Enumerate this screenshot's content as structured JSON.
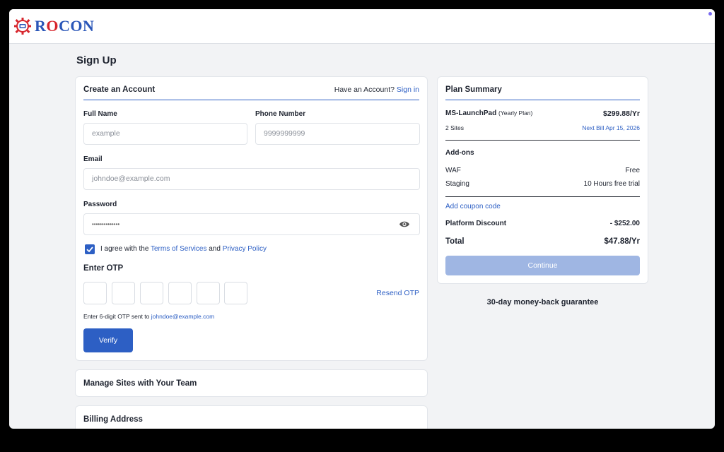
{
  "brand": {
    "name_part1": "R",
    "name_o": "O",
    "name_part2": "C",
    "name_o2": "O",
    "name_part3": "N",
    "color": "#2a56b8",
    "accent": "#d7262d"
  },
  "page": {
    "title": "Sign Up"
  },
  "account": {
    "title": "Create an Account",
    "have_account": "Have an Account?",
    "sign_in": "Sign in",
    "full_name_label": "Full Name",
    "full_name_placeholder": "example",
    "phone_label": "Phone Number",
    "phone_placeholder": "9999999999",
    "email_label": "Email",
    "email_placeholder": "johndoe@example.com",
    "password_label": "Password",
    "password_value": "••••••••••••••",
    "agree_prefix": "I agree with the",
    "terms": "Terms of Services",
    "agree_and": "and",
    "privacy": "Privacy Policy",
    "terms_checked": true,
    "otp_title": "Enter OTP",
    "resend": "Resend OTP",
    "otp_hint_prefix": "Enter 6-digit OTP sent to",
    "otp_hint_email": "johndoe@example.com",
    "verify": "Verify"
  },
  "team": {
    "title": "Manage Sites with Your Team"
  },
  "billing": {
    "title": "Billing Address"
  },
  "plan": {
    "title": "Plan Summary",
    "plan_name": "MS-LaunchPad",
    "plan_type": "(Yearly Plan)",
    "plan_price": "$299.88/Yr",
    "sites": "2 Sites",
    "next_bill": "Next Bill Apr 15, 2026",
    "addons_title": "Add-ons",
    "addons": [
      {
        "name": "WAF",
        "value": "Free"
      },
      {
        "name": "Staging",
        "value": "10 Hours free trial"
      }
    ],
    "coupon": "Add coupon code",
    "discount_label": "Platform Discount",
    "discount_value": "- $252.00",
    "total_label": "Total",
    "total_value": "$47.88/Yr",
    "continue": "Continue"
  },
  "guarantee": "30-day money-back guarantee",
  "colors": {
    "primary": "#2d5fc4",
    "continue_disabled": "#9fb6e3"
  }
}
